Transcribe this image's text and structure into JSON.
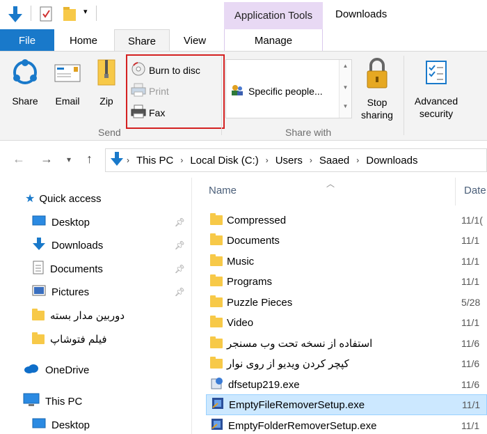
{
  "window": {
    "title": "Downloads"
  },
  "tabs": {
    "file": "File",
    "home": "Home",
    "share": "Share",
    "view": "View",
    "context_header": "Application Tools",
    "manage": "Manage"
  },
  "ribbon": {
    "send": {
      "share": "Share",
      "email": "Email",
      "zip": "Zip",
      "burn": "Burn to disc",
      "print": "Print",
      "fax": "Fax",
      "group_label": "Send"
    },
    "share_with": {
      "item": "Specific people...",
      "stop_line1": "Stop",
      "stop_line2": "sharing",
      "group_label": "Share with"
    },
    "advanced": {
      "line1": "Advanced",
      "line2": "security"
    }
  },
  "address": {
    "crumbs": [
      "This PC",
      "Local Disk (C:)",
      "Users",
      "Saaed",
      "Downloads"
    ]
  },
  "nav": {
    "quick_access": "Quick access",
    "items": [
      "Desktop",
      "Downloads",
      "Documents",
      "Pictures",
      "دوربین مدار بسته",
      "فیلم فتوشاپ"
    ],
    "onedrive": "OneDrive",
    "this_pc": "This PC",
    "desktop2": "Desktop"
  },
  "files": {
    "col_name": "Name",
    "col_date": "Date",
    "rows": [
      {
        "name": "Compressed",
        "date": "11/1("
      },
      {
        "name": "Documents",
        "date": "11/1"
      },
      {
        "name": "Music",
        "date": "11/1"
      },
      {
        "name": "Programs",
        "date": "11/1"
      },
      {
        "name": "Puzzle Pieces",
        "date": "5/28"
      },
      {
        "name": "Video",
        "date": "11/1"
      },
      {
        "name": "استفاده از نسخه تحت وب مسنجر",
        "date": "11/6"
      },
      {
        "name": "کپچر کردن ویدیو از روی نوار",
        "date": "11/6"
      },
      {
        "name": "dfsetup219.exe",
        "date": "11/6"
      },
      {
        "name": "EmptyFileRemoverSetup.exe",
        "date": "11/1"
      },
      {
        "name": "EmptyFolderRemoverSetup.exe",
        "date": "11/1"
      }
    ]
  },
  "colors": {
    "accent": "#1979ca",
    "context_tab": "#e8d9f4",
    "highlight": "#d42020",
    "selection": "#cce8ff"
  }
}
